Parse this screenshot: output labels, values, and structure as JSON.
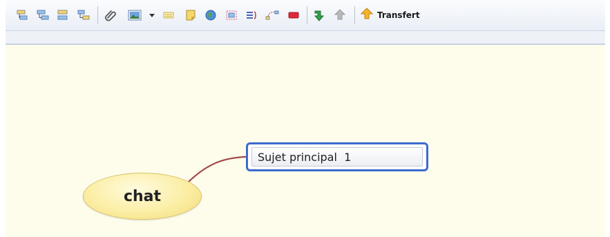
{
  "toolbar": {
    "icons": [
      "insert-subtopic-icon",
      "insert-topic-icon",
      "insert-topic-before-icon",
      "insert-parent-topic-icon",
      "attachment-icon",
      "image-icon",
      "dropdown-arrow-icon",
      "label-icon",
      "note-icon",
      "hyperlink-icon",
      "boundary-icon",
      "summary-icon",
      "relationship-icon",
      "marker-icon",
      "drill-down-icon",
      "drill-up-icon",
      "transfer-icon"
    ],
    "transfer_label": "Transfert"
  },
  "map": {
    "central_topic": "chat",
    "main_topic": "Sujet principal  1"
  },
  "colors": {
    "canvas": "#fefdec",
    "central_fill": "#fbeea4",
    "topic_border": "#3c6ad0",
    "connector": "#a04a4a"
  }
}
